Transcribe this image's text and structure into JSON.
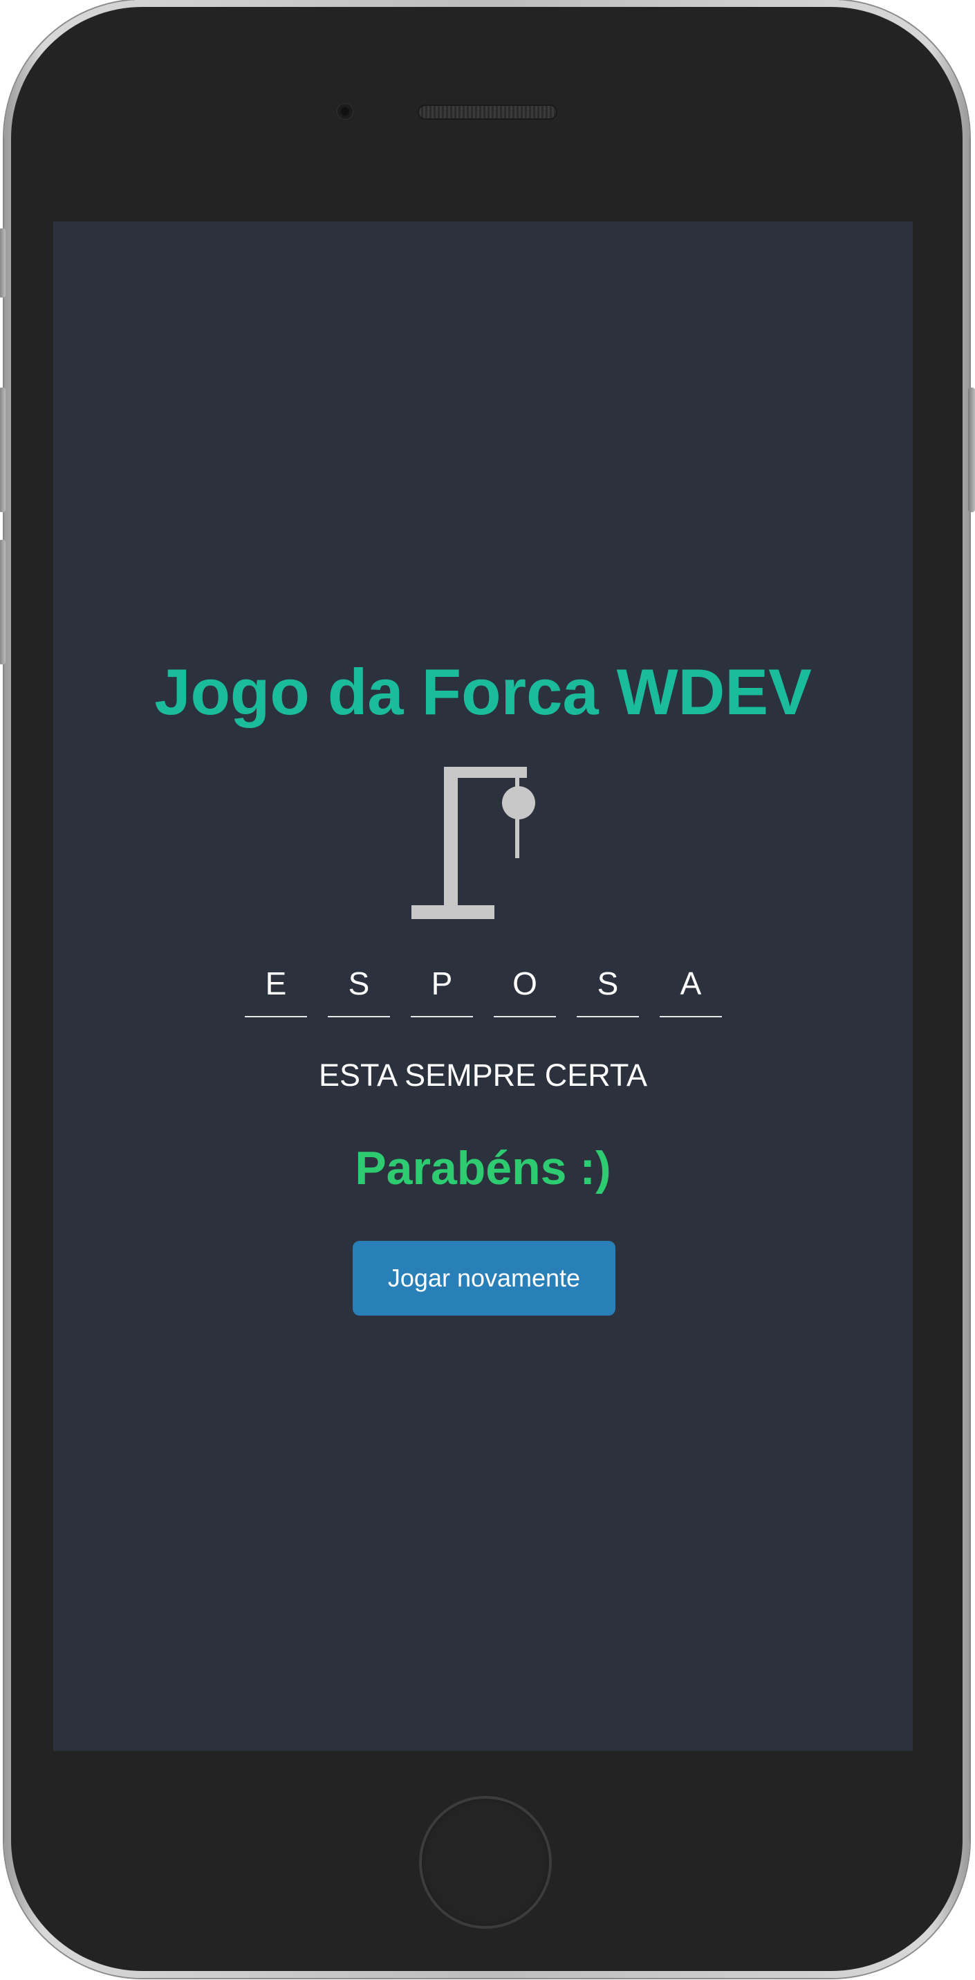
{
  "game": {
    "title": "Jogo da Forca WDEV",
    "word_letters": [
      "E",
      "S",
      "P",
      "O",
      "S",
      "A"
    ],
    "hint": "ESTA SEMPRE CERTA",
    "result": "Parabéns :)",
    "play_again_label": "Jogar novamente"
  },
  "colors": {
    "screen_bg": "#2b323e",
    "title": "#1abc9c",
    "result": "#2ecc71",
    "button": "#2980b9",
    "gallows": "#c8c8c8"
  }
}
